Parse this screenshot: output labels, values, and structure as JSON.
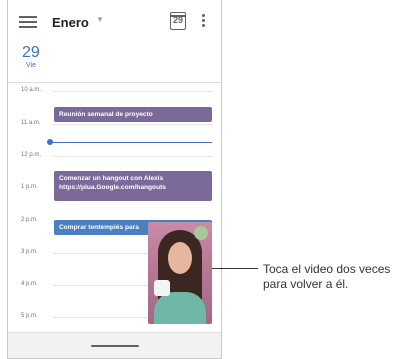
{
  "header": {
    "month": "Enero",
    "today_number": "29"
  },
  "day": {
    "number": "29",
    "name": "Vie"
  },
  "hours": [
    "10 a.m.",
    "11 a.m.",
    "12 p.m.",
    "1 p.m.",
    "2 p.m.",
    "3 p.m.",
    "4 p.m.",
    "5 p.m."
  ],
  "events": [
    {
      "title": "Reunión semanal de proyecto"
    },
    {
      "title": "Comenzar un hangout con Alexis",
      "detail": "https://plua.Google.com/hangouts"
    },
    {
      "title": "Comprar tentempiés para"
    }
  ],
  "callout": {
    "text": "Toca el video dos veces para volver a él."
  },
  "colors": {
    "accent": "#3a72c4",
    "event_purple": "#7b6a99",
    "event_blue": "#4a7fc1"
  }
}
